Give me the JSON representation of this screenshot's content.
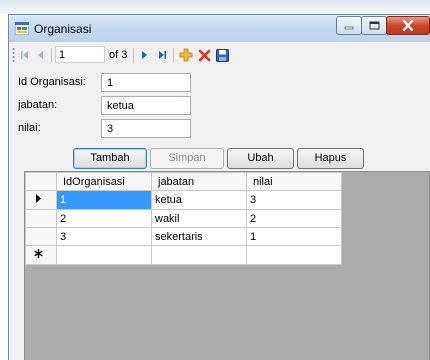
{
  "window": {
    "title": "Organisasi"
  },
  "navigator": {
    "position": "1",
    "of_label": "of 3"
  },
  "form": {
    "id_label": "Id Organisasi:",
    "id_value": "1",
    "jabatan_label": "jabatan:",
    "jabatan_value": "ketua",
    "nilai_label": "nilai:",
    "nilai_value": "3"
  },
  "buttons": {
    "tambah": "Tambah",
    "simpan": "Simpan",
    "ubah": "Ubah",
    "hapus": "Hapus"
  },
  "grid": {
    "headers": [
      "IdOrganisasi",
      "jabatan",
      "nilai"
    ],
    "rows": [
      [
        "1",
        "ketua",
        "3"
      ],
      [
        "2",
        "wakil",
        "2"
      ],
      [
        "3",
        "sekertaris",
        "1"
      ]
    ]
  },
  "colors": {
    "selection": "#3399ff",
    "grid_background": "#ababab",
    "add_icon": "#f0a020",
    "delete_icon": "#e03020",
    "nav_arrow": "#1f5fb8"
  }
}
